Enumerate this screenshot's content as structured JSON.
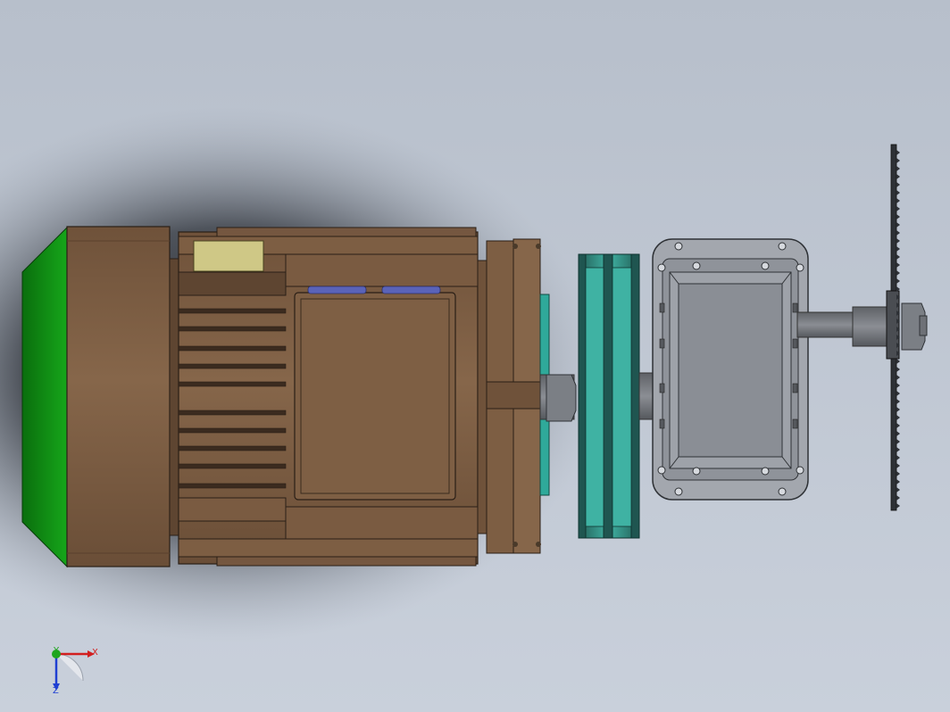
{
  "viewport": {
    "background_top": "#b9c0cc",
    "background_bottom": "#c8cfda",
    "shadow_color": "#1a1d22"
  },
  "parts": {
    "motor_end_cap_color": "#0f8a12",
    "motor_body_color": "#7d5e43",
    "motor_edge_color": "#2a1f16",
    "terminal_box_color": "#d0c98a",
    "coupling_color": "#2fa99a",
    "pulley_color": "#2b6f66",
    "gearbox_color": "#8e9299",
    "gearbox_plate_color": "#a6aab1",
    "shaft_color": "#6e7177",
    "blade_color": "#2e3136"
  },
  "triad": {
    "x_label": "X",
    "y_label": "Y",
    "z_label": "Z",
    "x_color": "#d21f1f",
    "y_color": "#1fa51f",
    "z_color": "#1f3fd2"
  }
}
